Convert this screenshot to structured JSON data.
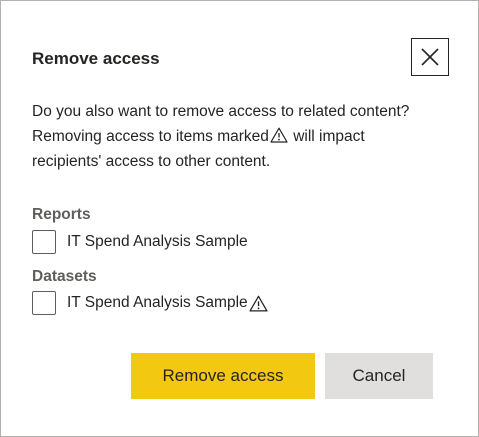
{
  "dialog": {
    "title": "Remove access",
    "close_icon": "close-icon",
    "message_line1": "Do you also want to remove access to related content?",
    "message_line2_before": "Removing access to items marked",
    "message_line2_after": "will impact recipients' access to other content.",
    "warning_icon": "warning-icon"
  },
  "sections": [
    {
      "label": "Reports",
      "items": [
        {
          "label": "IT Spend Analysis Sample",
          "checked": false,
          "warning": false
        }
      ]
    },
    {
      "label": "Datasets",
      "items": [
        {
          "label": "IT Spend Analysis Sample",
          "checked": false,
          "warning": true
        }
      ]
    }
  ],
  "buttons": {
    "primary_label": "Remove access",
    "secondary_label": "Cancel"
  },
  "colors": {
    "primary_button": "#f2c811",
    "secondary_button": "#e1dfdd",
    "section_label": "#605e5c",
    "text": "#252423"
  }
}
